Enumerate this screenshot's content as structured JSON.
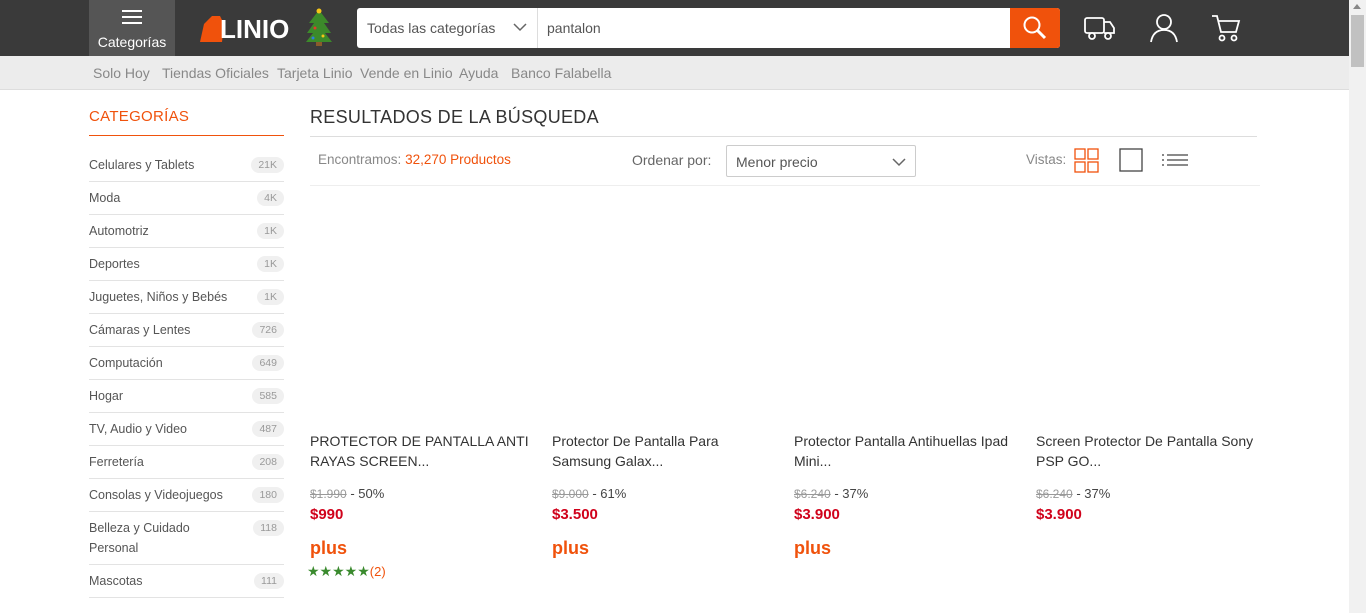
{
  "header": {
    "categories_label": "Categorías",
    "logo_text": "LINIO",
    "search": {
      "category_value": "Todas las categorías",
      "query": "pantalon"
    }
  },
  "icons": {
    "menu": "hamburger-icon",
    "tree": "christmas-tree-icon",
    "search": "search-icon",
    "truck": "truck-icon",
    "user": "user-icon",
    "cart": "cart-icon"
  },
  "colors": {
    "brand_orange": "#f0520c",
    "price_red": "#d0021b",
    "header_bg": "#3a3a3a",
    "star_green": "#3a8a2e"
  },
  "subnav": {
    "links": [
      "Solo Hoy",
      "Tiendas Oficiales",
      "Tarjeta Linio",
      "Vende en Linio",
      "Ayuda",
      "Banco Falabella"
    ]
  },
  "sidebar": {
    "title": "CATEGORÍAS",
    "items": [
      {
        "label": "Celulares y Tablets",
        "count": "21K"
      },
      {
        "label": "Moda",
        "count": "4K"
      },
      {
        "label": "Automotriz",
        "count": "1K"
      },
      {
        "label": "Deportes",
        "count": "1K"
      },
      {
        "label": "Juguetes, Niños y Bebés",
        "count": "1K"
      },
      {
        "label": "Cámaras y Lentes",
        "count": "726"
      },
      {
        "label": "Computación",
        "count": "649"
      },
      {
        "label": "Hogar",
        "count": "585"
      },
      {
        "label": "TV, Audio y Video",
        "count": "487"
      },
      {
        "label": "Ferretería",
        "count": "208"
      },
      {
        "label": "Consolas y Videojuegos",
        "count": "180"
      },
      {
        "label": "Belleza y Cuidado Personal",
        "count": "118"
      },
      {
        "label": "Mascotas",
        "count": "111"
      }
    ]
  },
  "results": {
    "title": "RESULTADOS DE LA BÚSQUEDA",
    "found_prefix": "Encontramos:",
    "found_count": "32,270 Productos",
    "order_label": "Ordenar por:",
    "order_value": "Menor precio",
    "views_label": "Vistas:"
  },
  "products": [
    {
      "name": "PROTECTOR DE PANTALLA ANTI RAYAS SCREEN...",
      "old_price": "$1.990",
      "discount": "- 50%",
      "price": "$990",
      "plus": "plus",
      "stars": "★★★★★",
      "reviews": "(2)"
    },
    {
      "name": "Protector De Pantalla Para Samsung Galax...",
      "old_price": "$9.000",
      "discount": "- 61%",
      "price": "$3.500",
      "plus": "plus"
    },
    {
      "name": "Protector Pantalla Antihuellas Ipad Mini...",
      "old_price": "$6.240",
      "discount": "- 37%",
      "price": "$3.900",
      "plus": "plus"
    },
    {
      "name": "Screen Protector De Pantalla Sony PSP GO...",
      "old_price": "$6.240",
      "discount": "- 37%",
      "price": "$3.900"
    }
  ]
}
